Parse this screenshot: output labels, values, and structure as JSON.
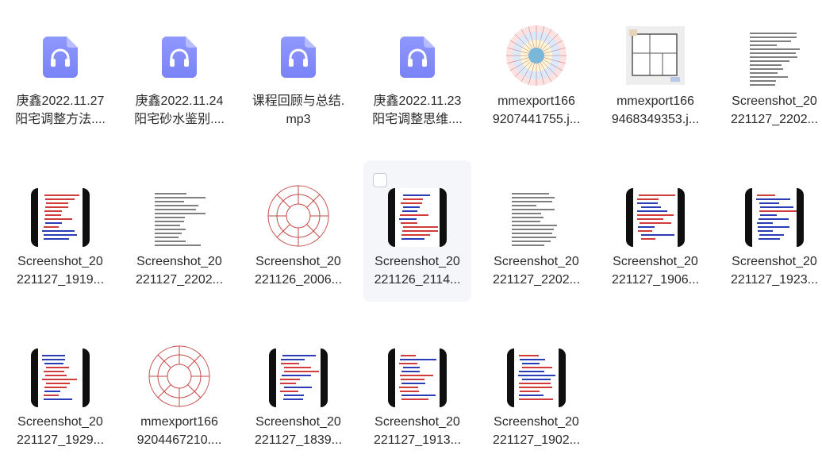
{
  "files": [
    {
      "name_line1": "庚鑫2022.11.27",
      "name_line2": "阳宅调整方法....",
      "kind": "audio",
      "icon": "headphones-icon"
    },
    {
      "name_line1": "庚鑫2022.11.24",
      "name_line2": "阳宅砂水鉴别....",
      "kind": "audio",
      "icon": "headphones-icon"
    },
    {
      "name_line1": "课程回顾与总结.",
      "name_line2": "mp3",
      "kind": "audio",
      "icon": "headphones-icon"
    },
    {
      "name_line1": "庚鑫2022.11.23",
      "name_line2": "阳宅调整思维....",
      "kind": "audio",
      "icon": "headphones-icon"
    },
    {
      "name_line1": "mmexport166",
      "name_line2": "9207441755.j...",
      "kind": "compass-chart",
      "icon": "compass-image-thumbnail"
    },
    {
      "name_line1": "mmexport166",
      "name_line2": "9468349353.j...",
      "kind": "floorplan",
      "icon": "floorplan-image-thumbnail"
    },
    {
      "name_line1": "Screenshot_20",
      "name_line2": "221127_2202...",
      "kind": "doc",
      "icon": "text-screenshot-thumbnail"
    },
    {
      "name_line1": "Screenshot_20",
      "name_line2": "221127_1919...",
      "kind": "phone",
      "icon": "phone-screenshot-thumbnail"
    },
    {
      "name_line1": "Screenshot_20",
      "name_line2": "221127_2202...",
      "kind": "doc",
      "icon": "text-screenshot-thumbnail"
    },
    {
      "name_line1": "Screenshot_20",
      "name_line2": "221126_2006...",
      "kind": "bagua",
      "icon": "bagua-image-thumbnail"
    },
    {
      "name_line1": "Screenshot_20",
      "name_line2": "221126_2114...",
      "kind": "phone",
      "icon": "phone-screenshot-thumbnail",
      "hovered": true
    },
    {
      "name_line1": "Screenshot_20",
      "name_line2": "221127_2202...",
      "kind": "doc",
      "icon": "text-screenshot-thumbnail"
    },
    {
      "name_line1": "Screenshot_20",
      "name_line2": "221127_1906...",
      "kind": "phone",
      "icon": "phone-screenshot-thumbnail"
    },
    {
      "name_line1": "Screenshot_20",
      "name_line2": "221127_1923...",
      "kind": "phone",
      "icon": "phone-screenshot-thumbnail"
    },
    {
      "name_line1": "Screenshot_20",
      "name_line2": "221127_1929...",
      "kind": "phone",
      "icon": "phone-screenshot-thumbnail"
    },
    {
      "name_line1": "mmexport166",
      "name_line2": "9204467210....",
      "kind": "bagua",
      "icon": "bagua-image-thumbnail"
    },
    {
      "name_line1": "Screenshot_20",
      "name_line2": "221127_1839...",
      "kind": "phone",
      "icon": "phone-screenshot-thumbnail"
    },
    {
      "name_line1": "Screenshot_20",
      "name_line2": "221127_1913...",
      "kind": "phone",
      "icon": "phone-screenshot-thumbnail"
    },
    {
      "name_line1": "Screenshot_20",
      "name_line2": "221127_1902...",
      "kind": "phone",
      "icon": "phone-screenshot-thumbnail"
    }
  ],
  "colors": {
    "audio_icon_top": "#8f98ff",
    "audio_icon_bottom": "#7a83f5",
    "phone_frame": "#0f0f0f",
    "text_red": "#d13b3b",
    "text_blue": "#2b3db6",
    "hover_bg": "#f4f6fa"
  }
}
